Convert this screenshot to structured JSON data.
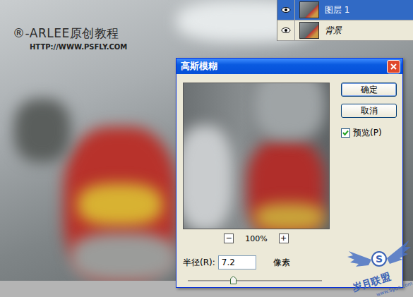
{
  "canvas": {
    "watermark": "®-ARLEE原创教程",
    "url": "HTTP://WWW.PSFLY.COM"
  },
  "layers": [
    {
      "name": "图层 1",
      "selected": true,
      "visible": true,
      "kind": "normal"
    },
    {
      "name": "背景",
      "selected": false,
      "visible": true,
      "kind": "background"
    }
  ],
  "dialog": {
    "title": "高斯模糊",
    "buttons": [
      {
        "label": "确定",
        "default": true
      },
      {
        "label": "取消",
        "default": false
      }
    ],
    "preview": {
      "label": "预览(P)",
      "checked": true
    },
    "zoom": {
      "minus": "−",
      "value": "100%",
      "plus": "+"
    },
    "radius": {
      "label": "半径(R):",
      "value": "7.2",
      "unit": "像素",
      "level": 0.34
    }
  },
  "logo": {
    "badge": "S",
    "name": "岁月联盟",
    "url": "www.Syue.com"
  }
}
